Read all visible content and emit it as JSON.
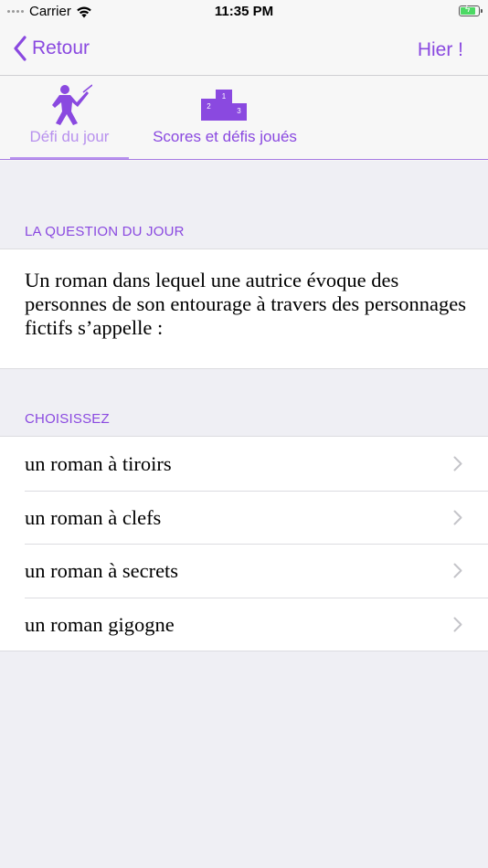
{
  "status_bar": {
    "carrier": "Carrier",
    "time": "11:35 PM"
  },
  "nav": {
    "back_label": "Retour",
    "right_label": "Hier !"
  },
  "tabs": [
    {
      "label": "Défi du jour",
      "icon": "fencer-icon",
      "selected": true
    },
    {
      "label": "Scores et défis joués",
      "icon": "podium-icon",
      "selected": false
    }
  ],
  "question": {
    "header": "LA QUESTION DU JOUR",
    "text": "Un roman dans lequel une autrice évoque des personnes de son entourage à travers des personnages fictifs s’appelle :"
  },
  "choices": {
    "header": "CHOISISSEZ",
    "items": [
      {
        "label": "un roman à tiroirs"
      },
      {
        "label": "un roman à clefs"
      },
      {
        "label": "un roman à secrets"
      },
      {
        "label": "un roman gigogne"
      }
    ]
  },
  "colors": {
    "accent": "#8a49e0",
    "accent_light": "#b891ee",
    "background": "#efeff4",
    "bar_background": "#f7f7f7"
  }
}
